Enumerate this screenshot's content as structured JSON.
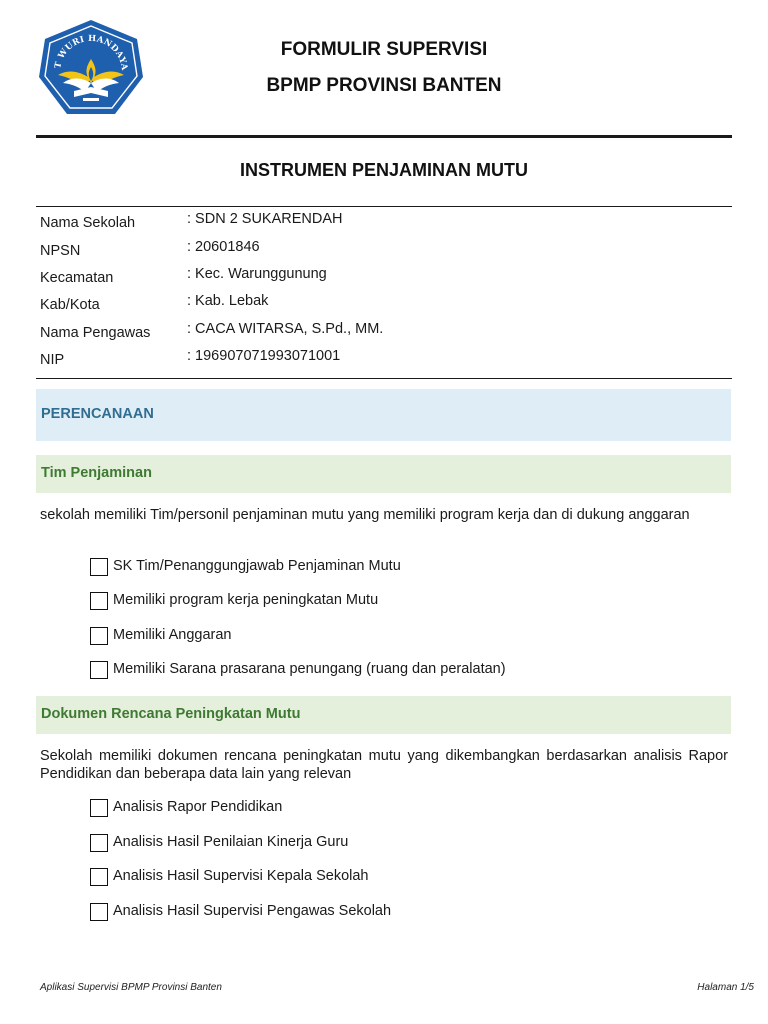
{
  "logo": {
    "motto": "TUT WURI HANDAYANI",
    "icon": "tut-wuri-handayani-logo",
    "colors": {
      "blue": "#1e5fae",
      "yellow": "#f2c418"
    }
  },
  "header": {
    "title_line1": "FORMULIR SUPERVISI",
    "title_line2": "BPMP PROVINSI BANTEN",
    "instrument_title": "INSTRUMEN PENJAMINAN MUTU"
  },
  "info": [
    {
      "label": "Nama Sekolah",
      "value": ": SDN 2 SUKARENDAH"
    },
    {
      "label": "NPSN",
      "value": ": 20601846"
    },
    {
      "label": "Kecamatan",
      "value": ": Kec. Warunggunung"
    },
    {
      "label": "Kab/Kota",
      "value": ": Kab. Lebak"
    },
    {
      "label": "Nama Pengawas",
      "value": ": CACA WITARSA, S.Pd., MM."
    },
    {
      "label": "NIP",
      "value": ": 196907071993071001"
    }
  ],
  "section": {
    "title": "PERENCANAAN",
    "color": "#2f6d92",
    "background": "#dfeef6"
  },
  "subsections": [
    {
      "title": "Tim Penjaminan",
      "description": "sekolah memiliki Tim/personil penjaminan mutu yang memiliki program kerja dan di dukung anggaran",
      "items": [
        {
          "label": "SK Tim/Penanggungjawab Penjaminan Mutu",
          "checked": false
        },
        {
          "label": "Memiliki program kerja peningkatan Mutu",
          "checked": false
        },
        {
          "label": "Memiliki Anggaran",
          "checked": false
        },
        {
          "label": "Memiliki Sarana prasarana penungang (ruang dan peralatan)",
          "checked": false
        }
      ]
    },
    {
      "title": "Dokumen Rencana Peningkatan Mutu",
      "description": "Sekolah memiliki dokumen rencana peningkatan mutu yang dikembangkan berdasarkan analisis Rapor Pendidikan dan beberapa  data lain yang relevan",
      "items": [
        {
          "label": "Analisis Rapor Pendidikan",
          "checked": false
        },
        {
          "label": "Analisis Hasil Penilaian Kinerja Guru",
          "checked": false
        },
        {
          "label": "Analisis Hasil Supervisi Kepala Sekolah",
          "checked": false
        },
        {
          "label": "Analisis Hasil Supervisi Pengawas Sekolah",
          "checked": false
        }
      ]
    }
  ],
  "footer": {
    "left": "Aplikasi Supervisi BPMP Provinsi Banten",
    "right": "Halaman 1/5"
  }
}
